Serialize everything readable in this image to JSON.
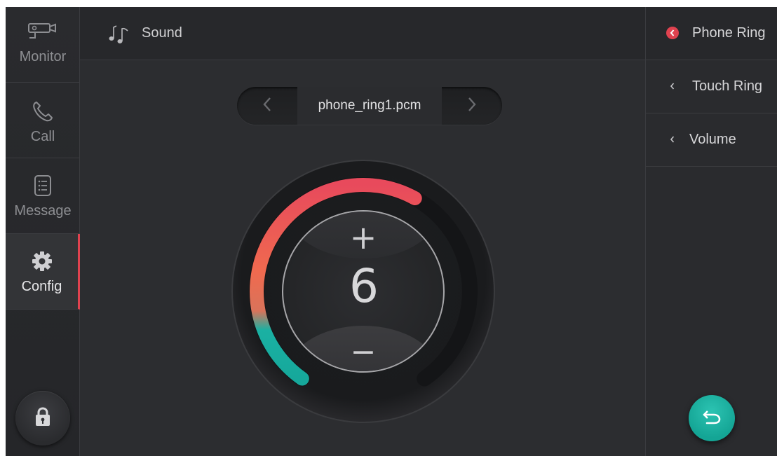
{
  "sidebar": {
    "items": [
      {
        "label": "Monitor",
        "icon": "camera-icon",
        "active": false
      },
      {
        "label": "Call",
        "icon": "phone-icon",
        "active": false
      },
      {
        "label": "Message",
        "icon": "message-icon",
        "active": false
      },
      {
        "label": "Config",
        "icon": "gear-icon",
        "active": true
      }
    ],
    "lock_icon": "lock-icon"
  },
  "header": {
    "icon": "music-note-icon",
    "title": "Sound"
  },
  "selector": {
    "file": "phone_ring1.pcm"
  },
  "volume": {
    "value": "6",
    "max": 10,
    "plus_label": "+",
    "minus_label": "−"
  },
  "right_panel": {
    "items": [
      {
        "label": "Phone Ring",
        "active": true
      },
      {
        "label": "Touch Ring",
        "active": false
      },
      {
        "label": "Volume",
        "active": false
      }
    ]
  },
  "colors": {
    "accent_red": "#e0424f",
    "accent_teal": "#17b3a3",
    "background": "#2c2d30"
  }
}
